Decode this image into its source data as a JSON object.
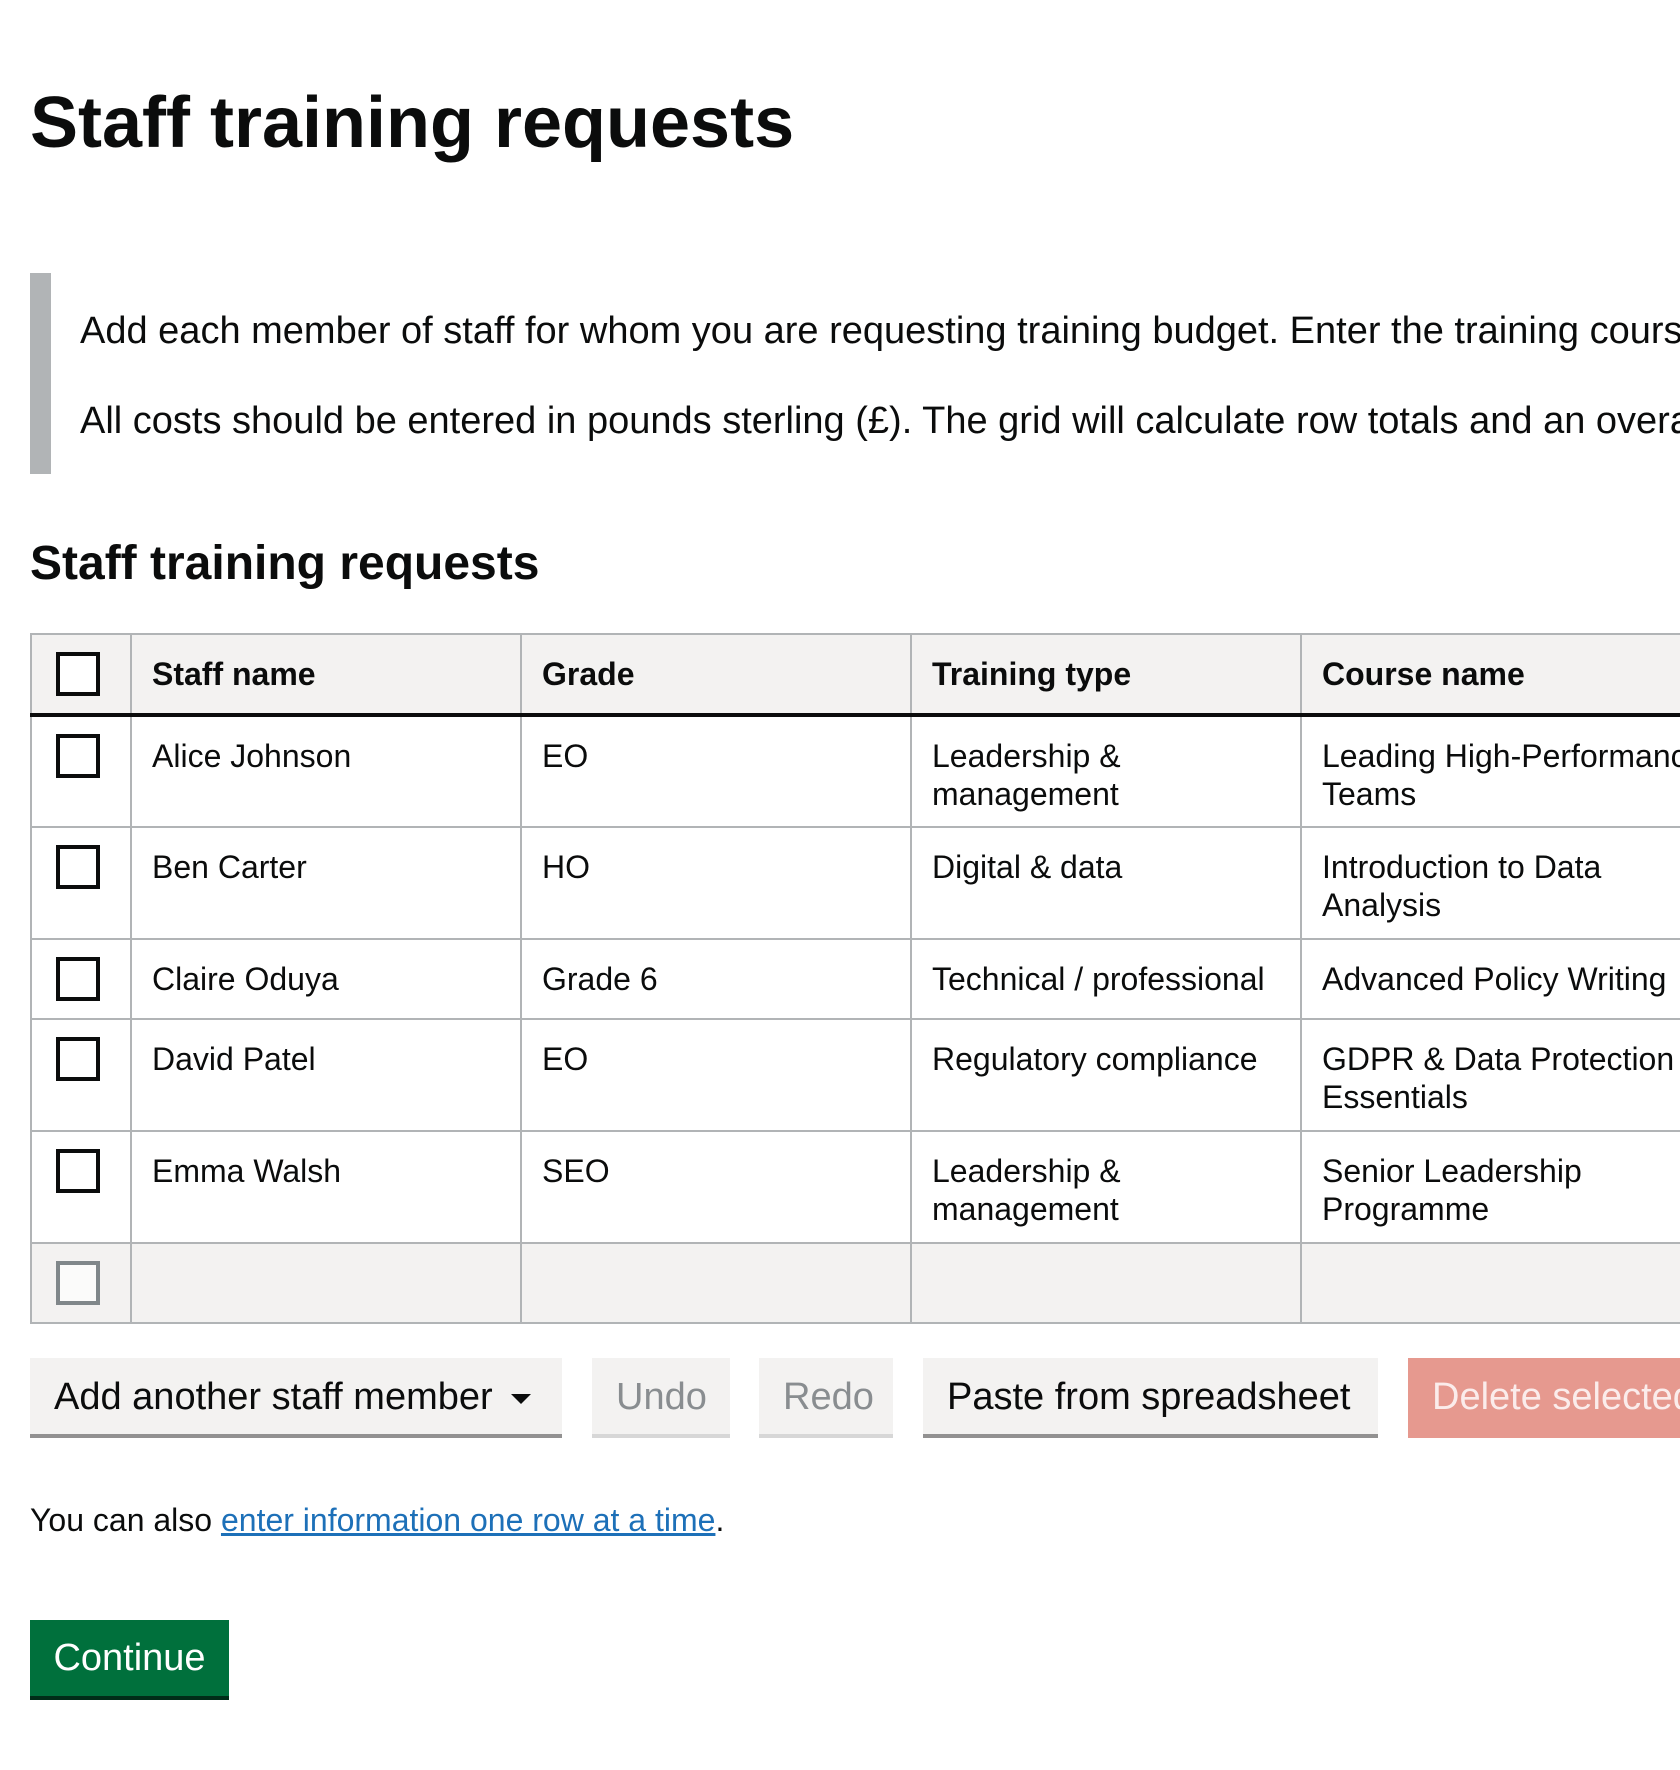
{
  "page": {
    "title": "Staff training requests"
  },
  "inset": {
    "p1": "Add each member of staff for whom you are requesting training budget. Enter the training course details and costs.",
    "p2": "All costs should be entered in pounds sterling (£). The grid will calculate row totals and an overall total."
  },
  "grid": {
    "title": "Staff training requests",
    "columns": {
      "staff_name": "Staff name",
      "grade": "Grade",
      "training_type": "Training type",
      "course_name": "Course name"
    },
    "rows": [
      {
        "staff_name": "Alice Johnson",
        "grade": "EO",
        "training_type": "Leadership & management",
        "course_name": "Leading High-Performance Teams"
      },
      {
        "staff_name": "Ben Carter",
        "grade": "HO",
        "training_type": "Digital & data",
        "course_name": "Introduction to Data Analysis"
      },
      {
        "staff_name": "Claire Oduya",
        "grade": "Grade 6",
        "training_type": "Technical / professional",
        "course_name": "Advanced Policy Writing"
      },
      {
        "staff_name": "David Patel",
        "grade": "EO",
        "training_type": "Regulatory compliance",
        "course_name": "GDPR & Data Protection Essentials"
      },
      {
        "staff_name": "Emma Walsh",
        "grade": "SEO",
        "training_type": "Leadership & management",
        "course_name": "Senior Leadership Programme"
      }
    ]
  },
  "toolbar": {
    "add_label": "Add another staff member",
    "undo_label": "Undo",
    "redo_label": "Redo",
    "paste_label": "Paste from spreadsheet",
    "delete_label": "Delete selected"
  },
  "hint": {
    "prefix": "You can also ",
    "link": "enter information one row at a time",
    "suffix": "."
  },
  "continue_label": "Continue"
}
